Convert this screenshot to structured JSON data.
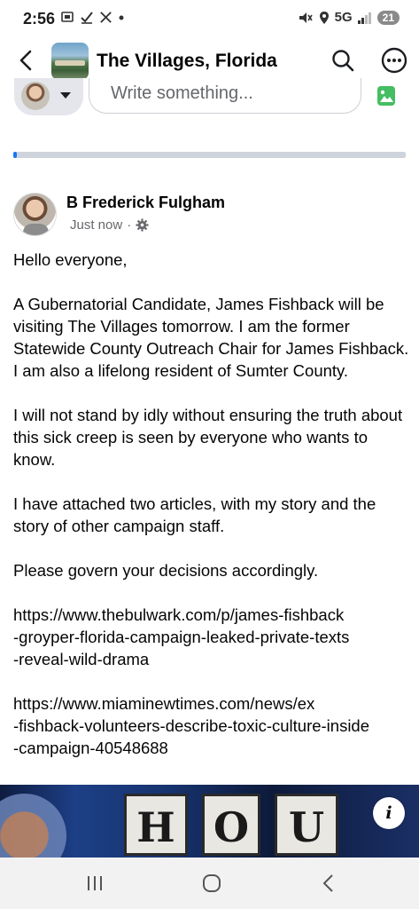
{
  "status_bar": {
    "time": "2:56",
    "network": "5G",
    "battery": "21",
    "icons": [
      "screenshot-icon",
      "check-icon",
      "x-app-icon",
      "dot-icon",
      "mute-icon",
      "location-icon",
      "signal-icon"
    ]
  },
  "header": {
    "title": "The Villages, Florida",
    "icons": [
      "back-arrow-icon",
      "search-icon",
      "more-icon"
    ]
  },
  "composer": {
    "placeholder": "Write something..."
  },
  "upload_progress": 0.01,
  "post": {
    "author": "B Frederick Fulgham",
    "timestamp": "Just now",
    "separator": "·",
    "paragraphs": [
      "Hello everyone,",
      "A Gubernatorial Candidate, James Fishback will be visiting The Villages tomorrow. I am the former Statewide County Outreach Chair for James Fishback. I am also a lifelong resident of Sumter County.",
      "I will not stand by idly without ensuring the truth about this sick creep is seen by everyone who wants to know.",
      "I have attached two articles, with my story and the story of other campaign staff.",
      "Please govern your decisions accordingly."
    ],
    "links": [
      [
        "https://www.thebulwark.com/p/james-fishback",
        "-groyper-florida-campaign-leaked-private-texts",
        "-reveal-wild-drama"
      ],
      [
        "https://www.miaminewtimes.com/news/ex",
        "-fishback-volunteers-describe-toxic-culture-inside",
        "-campaign-40548688"
      ]
    ],
    "media": {
      "sign_letters": [
        "H",
        "O",
        "U"
      ],
      "info_label": "i"
    }
  },
  "nav": {
    "icons": [
      "recent-apps-icon",
      "home-icon",
      "back-icon"
    ]
  },
  "colors": {
    "accent": "#1877f2",
    "text": "#050505",
    "muted": "#65676b"
  }
}
